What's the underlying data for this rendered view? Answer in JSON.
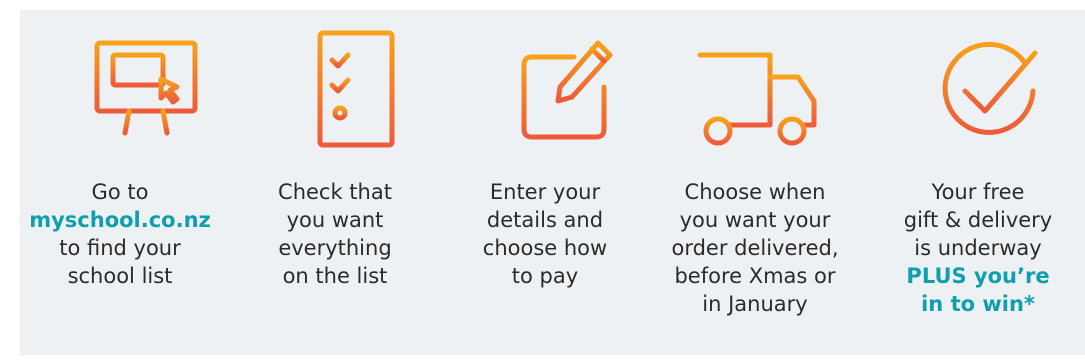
{
  "steps": [
    {
      "icon": "computer-cursor-icon",
      "lines": [
        "Go to",
        "myschool.co.nz",
        "to find your",
        "school list"
      ],
      "highlight_lines": [
        1
      ]
    },
    {
      "icon": "checklist-icon",
      "lines": [
        "Check that",
        "you want",
        "everything",
        "on the list"
      ],
      "highlight_lines": []
    },
    {
      "icon": "edit-pencil-icon",
      "lines": [
        "Enter your",
        "details and",
        "choose how",
        "to pay"
      ],
      "highlight_lines": []
    },
    {
      "icon": "delivery-truck-icon",
      "lines": [
        "Choose when",
        "you want your",
        "order delivered,",
        "before Xmas or",
        "in January"
      ],
      "highlight_lines": []
    },
    {
      "icon": "checkmark-circle-icon",
      "lines": [
        "Your free",
        "gift & delivery",
        "is underway",
        "PLUS you’re",
        "in to win*"
      ],
      "highlight_lines": [
        3,
        4
      ]
    }
  ],
  "colors": {
    "panel_background": "#eef1f4",
    "text": "#2b2b2b",
    "highlight_teal": "#0f9fad",
    "icon_gradient_top": "#f7a21b",
    "icon_gradient_bottom": "#ee5a3a"
  }
}
